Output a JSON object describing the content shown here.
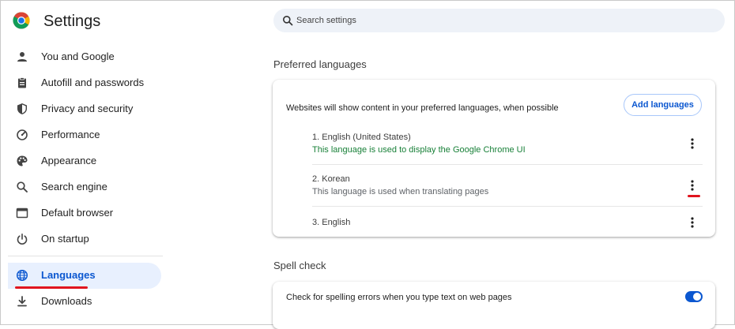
{
  "app": {
    "title": "Settings"
  },
  "search": {
    "placeholder": "Search settings"
  },
  "sidebar": {
    "items": [
      {
        "label": "You and Google",
        "icon": "person-icon"
      },
      {
        "label": "Autofill and passwords",
        "icon": "clipboard-icon"
      },
      {
        "label": "Privacy and security",
        "icon": "shield-icon"
      },
      {
        "label": "Performance",
        "icon": "speedometer-icon"
      },
      {
        "label": "Appearance",
        "icon": "palette-icon"
      },
      {
        "label": "Search engine",
        "icon": "search-icon"
      },
      {
        "label": "Default browser",
        "icon": "browser-window-icon"
      },
      {
        "label": "On startup",
        "icon": "power-icon"
      },
      {
        "label": "Languages",
        "icon": "globe-icon",
        "active": true
      },
      {
        "label": "Downloads",
        "icon": "download-icon"
      }
    ]
  },
  "preferred_languages": {
    "title": "Preferred languages",
    "description": "Websites will show content in your preferred languages, when possible",
    "add_button": "Add languages",
    "languages": [
      {
        "name": "1. English (United States)",
        "note": "This language is used to display the Google Chrome UI",
        "note_color": "#188038"
      },
      {
        "name": "2. Korean",
        "note": "This language is used when translating pages",
        "note_color": "#5f6368"
      },
      {
        "name": "3. English",
        "note": ""
      }
    ]
  },
  "spell_check": {
    "title": "Spell check",
    "option": "Check for spelling errors when you type text on web pages",
    "enabled": true
  },
  "colors": {
    "accent": "#0b57d0",
    "active_bg": "#e8f0fe",
    "highlight_marker": "#e0141e",
    "success_text": "#188038"
  }
}
